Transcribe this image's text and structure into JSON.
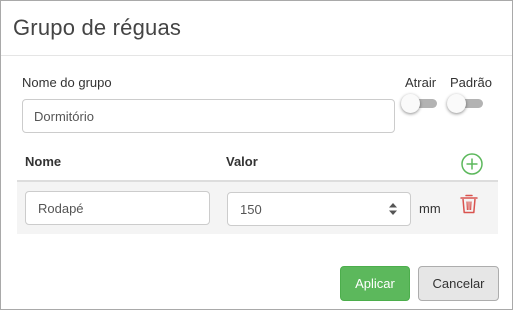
{
  "dialog": {
    "title": "Grupo de réguas"
  },
  "group": {
    "label": "Nome do grupo",
    "value": "Dormitório"
  },
  "toggles": {
    "attract": {
      "label": "Atrair",
      "on": false
    },
    "default": {
      "label": "Padrão",
      "on": false
    }
  },
  "table": {
    "headers": {
      "name": "Nome",
      "value": "Valor"
    },
    "add_icon": "plus-circle-icon",
    "rows": [
      {
        "name": "Rodapé",
        "value": "150",
        "unit": "mm",
        "delete_icon": "trash-icon"
      }
    ]
  },
  "footer": {
    "apply_label": "Aplicar",
    "cancel_label": "Cancelar"
  },
  "colors": {
    "apply": "#5cb85c",
    "add": "#5cb85c",
    "delete": "#d9534f"
  }
}
